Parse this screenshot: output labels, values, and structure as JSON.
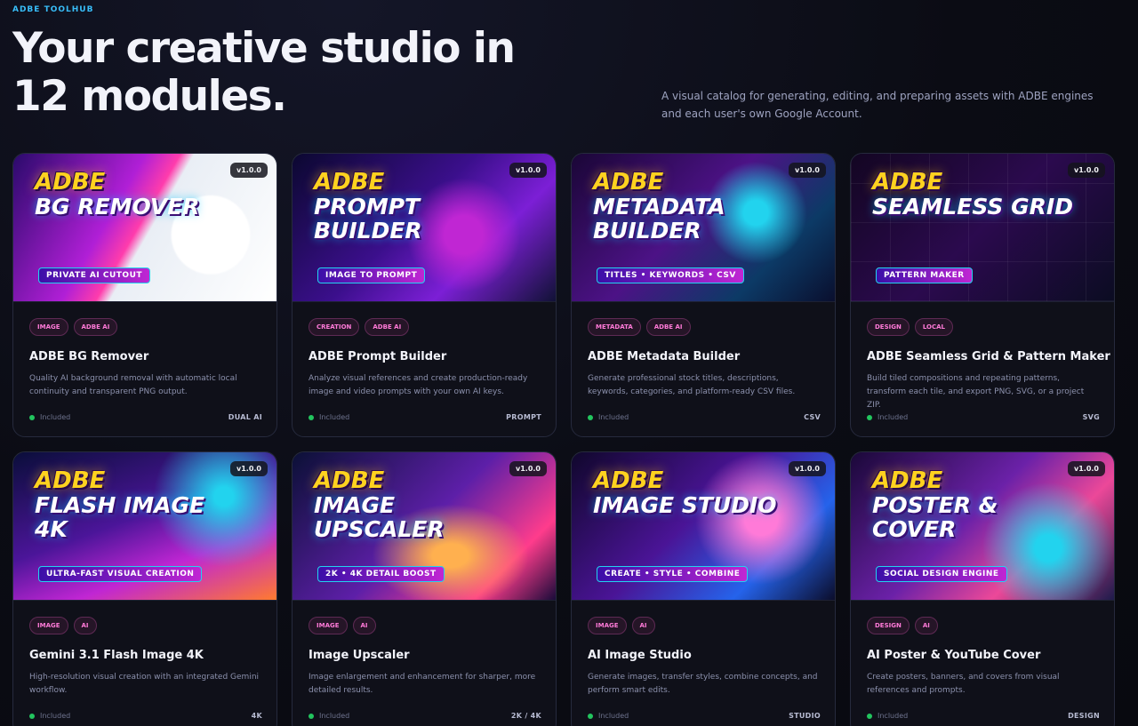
{
  "header": {
    "eyebrow": "ADBE TOOLHUB",
    "title": "Your creative studio in 12 modules.",
    "description": "A visual catalog for generating, editing, and preparing assets with ADBE engines and each user's own Google Account."
  },
  "colors": {
    "accent": "#38bdf8",
    "tag_text": "#ff7ad8",
    "status_dot": "#22c55e"
  },
  "modules": [
    {
      "thumb": {
        "brand": "ADBE",
        "product": "BG Remover",
        "ribbon": "PRIVATE AI CUTOUT"
      },
      "version": "v1.0.0",
      "tags": [
        "IMAGE",
        "ADBE AI"
      ],
      "title": "ADBE BG Remover",
      "description": "Quality AI background removal with automatic local continuity and transparent PNG output.",
      "status": "Included",
      "kind": "DUAL AI"
    },
    {
      "thumb": {
        "brand": "ADBE",
        "product": "Prompt Builder",
        "ribbon": "IMAGE TO PROMPT"
      },
      "version": "v1.0.0",
      "tags": [
        "CREATION",
        "ADBE AI"
      ],
      "title": "ADBE Prompt Builder",
      "description": "Analyze visual references and create production-ready image and video prompts with your own AI keys.",
      "status": "Included",
      "kind": "PROMPT"
    },
    {
      "thumb": {
        "brand": "ADBE",
        "product": "Metadata Builder",
        "ribbon": "TITLES • KEYWORDS • CSV"
      },
      "version": "v1.0.0",
      "tags": [
        "METADATA",
        "ADBE AI"
      ],
      "title": "ADBE Metadata Builder",
      "description": "Generate professional stock titles, descriptions, keywords, categories, and platform-ready CSV files.",
      "status": "Included",
      "kind": "CSV"
    },
    {
      "thumb": {
        "brand": "ADBE",
        "product": "Seamless Grid",
        "ribbon": "PATTERN MAKER"
      },
      "version": "v1.0.0",
      "tags": [
        "DESIGN",
        "LOCAL"
      ],
      "title": "ADBE Seamless Grid & Pattern Maker",
      "description": "Build tiled compositions and repeating patterns, transform each tile, and export PNG, SVG, or a project ZIP.",
      "status": "Included",
      "kind": "SVG"
    },
    {
      "thumb": {
        "brand": "ADBE",
        "product": "Flash Image 4K",
        "ribbon": "ULTRA-FAST VISUAL CREATION"
      },
      "version": "v1.0.0",
      "tags": [
        "IMAGE",
        "AI"
      ],
      "title": "Gemini 3.1 Flash Image 4K",
      "description": "High-resolution visual creation with an integrated Gemini workflow.",
      "status": "Included",
      "kind": "4K"
    },
    {
      "thumb": {
        "brand": "ADBE",
        "product": "Image Upscaler",
        "ribbon": "2K • 4K DETAIL BOOST"
      },
      "version": "v1.0.0",
      "tags": [
        "IMAGE",
        "AI"
      ],
      "title": "Image Upscaler",
      "description": "Image enlargement and enhancement for sharper, more detailed results.",
      "status": "Included",
      "kind": "2K / 4K"
    },
    {
      "thumb": {
        "brand": "ADBE",
        "product": "Image Studio",
        "ribbon": "CREATE • STYLE • COMBINE"
      },
      "version": "v1.0.0",
      "tags": [
        "IMAGE",
        "AI"
      ],
      "title": "AI Image Studio",
      "description": "Generate images, transfer styles, combine concepts, and perform smart edits.",
      "status": "Included",
      "kind": "STUDIO"
    },
    {
      "thumb": {
        "brand": "ADBE",
        "product": "Poster & Cover",
        "ribbon": "SOCIAL DESIGN ENGINE"
      },
      "version": "v1.0.0",
      "tags": [
        "DESIGN",
        "AI"
      ],
      "title": "AI Poster & YouTube Cover",
      "description": "Create posters, banners, and covers from visual references and prompts.",
      "status": "Included",
      "kind": "DESIGN"
    }
  ]
}
